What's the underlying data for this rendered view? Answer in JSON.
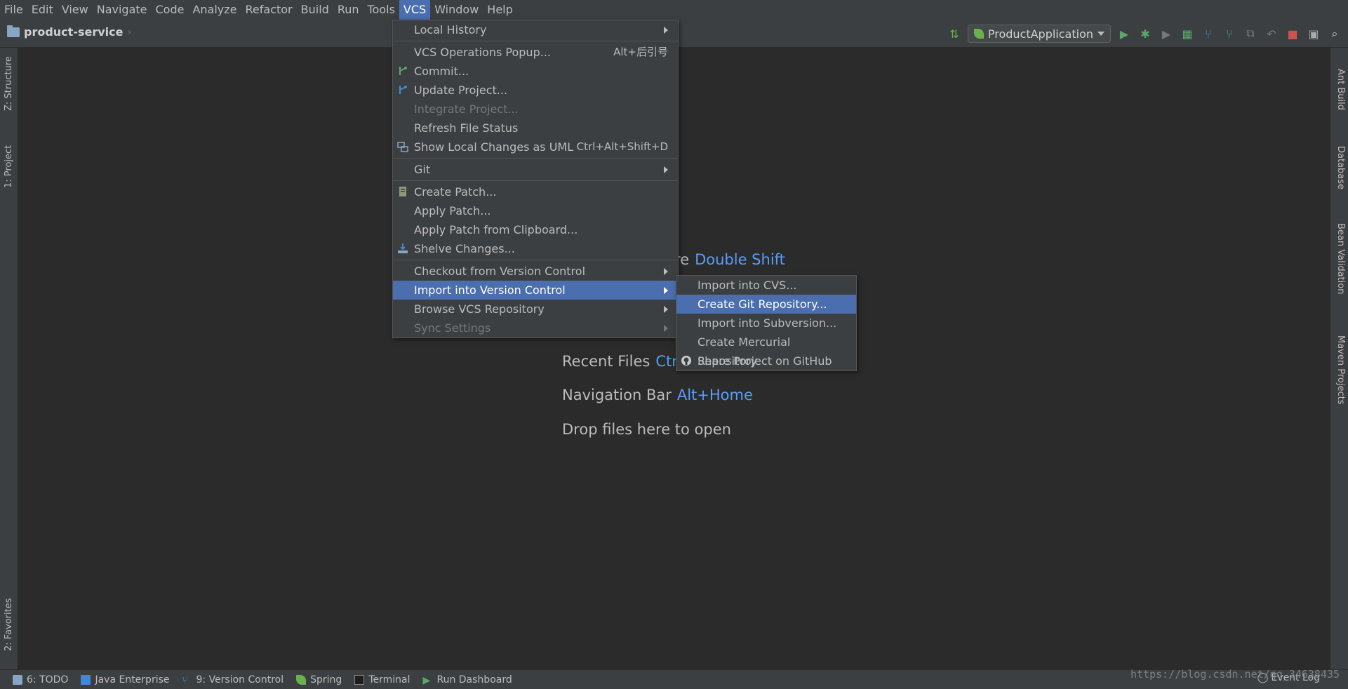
{
  "menubar": {
    "items": [
      "File",
      "Edit",
      "View",
      "Navigate",
      "Code",
      "Analyze",
      "Refactor",
      "Build",
      "Run",
      "Tools",
      "VCS",
      "Window",
      "Help"
    ],
    "active": "VCS"
  },
  "navbar": {
    "project": "product-service",
    "run_config": "ProductApplication"
  },
  "left_tabs": [
    "Z: Structure",
    "1: Project",
    "2: Favorites"
  ],
  "right_tabs": [
    "Ant Build",
    "Database",
    "Bean Validation",
    "Maven Projects"
  ],
  "editor_hints": {
    "search_tail": "re",
    "search_key": "Double Shift",
    "recent_label": "Recent Files",
    "recent_key": "Ctrl",
    "navbar_label": "Navigation Bar",
    "navbar_key": "Alt+Home",
    "drop": "Drop files here to open"
  },
  "vcs_menu": {
    "items": [
      {
        "label": "Local History",
        "submenu": true
      },
      {
        "label": "VCS Operations Popup...",
        "shortcut": "Alt+后引号"
      },
      {
        "label": "Commit...",
        "icon": "commit-icon"
      },
      {
        "label": "Update Project...",
        "icon": "update-icon"
      },
      {
        "label": "Integrate Project...",
        "disabled": true
      },
      {
        "label": "Refresh File Status"
      },
      {
        "label": "Show Local Changes as UML",
        "shortcut": "Ctrl+Alt+Shift+D",
        "icon": "uml-icon"
      },
      {
        "label": "Git",
        "submenu": true
      },
      {
        "label": "Create Patch...",
        "icon": "patch-icon"
      },
      {
        "label": "Apply Patch..."
      },
      {
        "label": "Apply Patch from Clipboard..."
      },
      {
        "label": "Shelve Changes...",
        "icon": "shelve-icon"
      },
      {
        "label": "Checkout from Version Control",
        "submenu": true
      },
      {
        "label": "Import into Version Control",
        "submenu": true,
        "selected": true
      },
      {
        "label": "Browse VCS Repository",
        "submenu": true
      },
      {
        "label": "Sync Settings",
        "submenu": true,
        "disabled": true
      }
    ]
  },
  "import_submenu": {
    "items": [
      {
        "label": "Import into CVS..."
      },
      {
        "label": "Create Git Repository...",
        "selected": true
      },
      {
        "label": "Import into Subversion..."
      },
      {
        "label": "Create Mercurial Repository"
      },
      {
        "label": "Share Project on GitHub",
        "icon": "github-icon"
      }
    ]
  },
  "bottom_tools": [
    "6: TODO",
    "Java Enterprise",
    "9: Version Control",
    "Spring",
    "Terminal",
    "Run Dashboard"
  ],
  "event_log": "Event Log",
  "watermark": "https://blog.csdn.net/qq_34638435",
  "colors": {
    "accent": "#4b6eaf",
    "key": "#589df6",
    "bg": "#2b2b2b",
    "panel": "#3c3f41"
  }
}
